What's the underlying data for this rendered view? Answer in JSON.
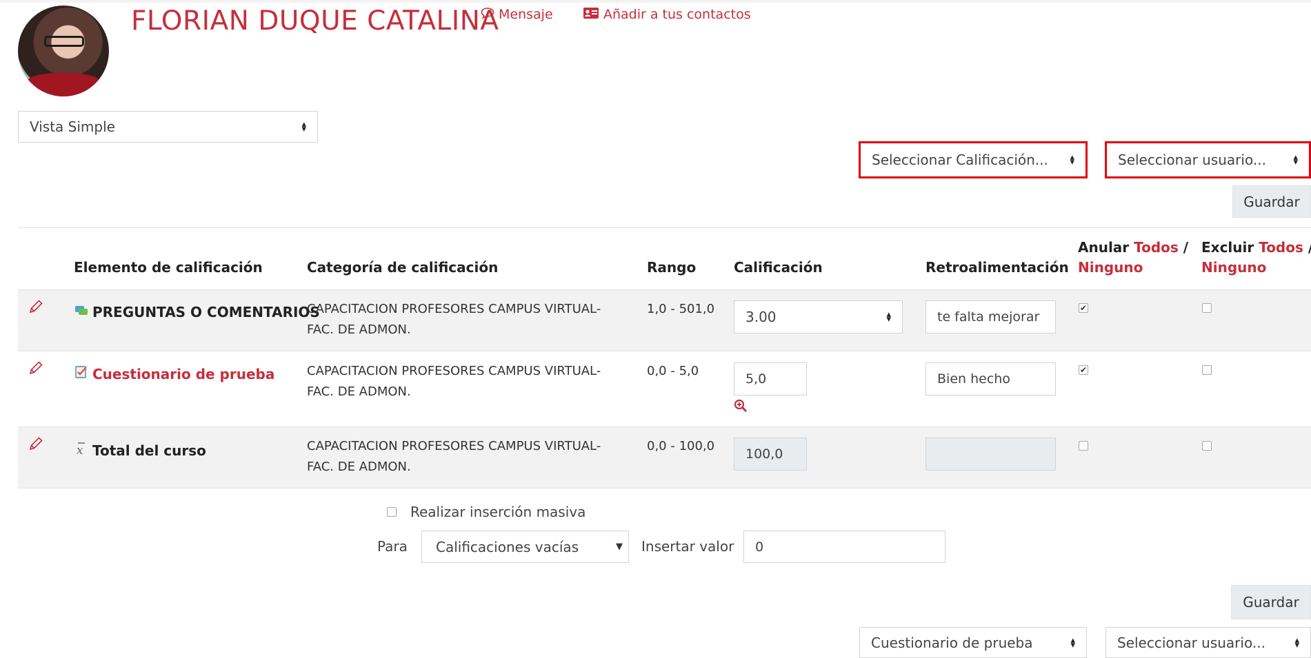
{
  "user": {
    "name": "FLORIAN DUQUE CATALINA",
    "message_label": "Mensaje",
    "add_contact_label": "Añadir a tus contactos"
  },
  "view_select": {
    "value": "Vista Simple"
  },
  "top_selects": {
    "grade_item": "Seleccionar Calificación...",
    "user": "Seleccionar usuario..."
  },
  "save_label": "Guardar",
  "table": {
    "headers": {
      "item": "Elemento de calificación",
      "category": "Categoría de calificación",
      "range": "Rango",
      "grade": "Calificación",
      "feedback": "Retroalimentación",
      "override": "Anular",
      "exclude": "Excluir",
      "all": "Todos",
      "slash": "/",
      "none": "Ninguno"
    },
    "rows": [
      {
        "item": "PREGUNTAS O COMENTARIOS",
        "category_line1": "CAPACITACION PROFESORES CAMPUS VIRTUAL-",
        "category_line2": "FAC. DE ADMON.",
        "range": "1,0 - 501,0",
        "grade": "3.00",
        "feedback": "te falta mejorar",
        "override_checked": true,
        "exclude_checked": false
      },
      {
        "item": "Cuestionario de prueba",
        "category_line1": "CAPACITACION PROFESORES CAMPUS VIRTUAL-",
        "category_line2": "FAC. DE ADMON.",
        "range": "0,0 - 5,0",
        "grade": "5,0",
        "feedback": "Bien hecho",
        "override_checked": true,
        "exclude_checked": false
      },
      {
        "item": "Total del curso",
        "category_line1": "CAPACITACION PROFESORES CAMPUS VIRTUAL-",
        "category_line2": "FAC. DE ADMON.",
        "range": "0,0 - 100,0",
        "grade": "100,0",
        "feedback": "",
        "override_checked": false,
        "exclude_checked": false
      }
    ]
  },
  "bulk": {
    "checkbox_label": "Realizar inserción masiva",
    "for_label": "Para",
    "for_value": "Calificaciones vacías",
    "insert_label": "Insertar valor",
    "insert_value": "0"
  },
  "bottom_selects": {
    "grade_item": "Cuestionario de prueba",
    "user": "Seleccionar usuario..."
  },
  "icons": {
    "message": "speech-bubble-icon",
    "contact": "address-card-icon",
    "edit": "pencil-icon",
    "forum": "forum-icon",
    "quiz": "quiz-icon",
    "total": "x-bar-mean-icon",
    "zoom": "zoom-in-icon"
  },
  "colors": {
    "brand": "#c62e3b",
    "highlight_red": "#e3000f",
    "highlight_green": "#35e035"
  }
}
